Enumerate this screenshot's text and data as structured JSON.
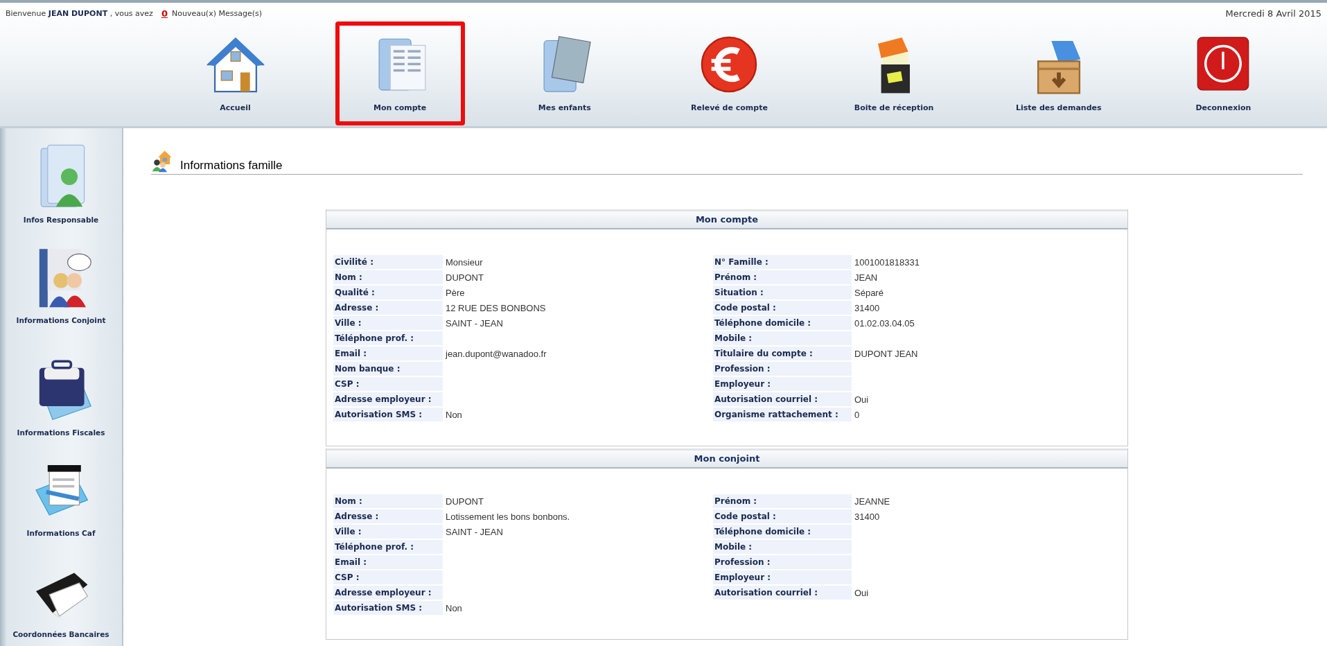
{
  "header": {
    "greeting": "Bienvenue **JEAN DUPONT** , vous avez",
    "message_count": "0",
    "message_label": "Nouveau(x) Message(s)",
    "date": "Mercredi 8 Avril 2015"
  },
  "nav": [
    {
      "label": "Accueil",
      "selected": false
    },
    {
      "label": "Mon compte",
      "selected": true
    },
    {
      "label": "Mes enfants",
      "selected": false
    },
    {
      "label": "Relevé de compte",
      "selected": false
    },
    {
      "label": "Boite de réception",
      "selected": false
    },
    {
      "label": "Liste des demandes",
      "selected": false
    },
    {
      "label": "Deconnexion",
      "selected": false
    }
  ],
  "sidebar": [
    {
      "label": "Infos Responsable"
    },
    {
      "label": "Informations Conjoint"
    },
    {
      "label": "Informations Fiscales"
    },
    {
      "label": "Informations Caf"
    },
    {
      "label": "Coordonnées Bancaires"
    }
  ],
  "page_title": "Informations famille",
  "panels": [
    {
      "title": "Mon compte",
      "left": [
        {
          "label": "Civilité :",
          "value": "Monsieur"
        },
        {
          "label": "Nom :",
          "value": "DUPONT"
        },
        {
          "label": "Qualité :",
          "value": "Père"
        },
        {
          "label": "Adresse :",
          "value": "12 RUE DES BONBONS"
        },
        {
          "label": "Ville :",
          "value": "SAINT - JEAN"
        },
        {
          "label": "Téléphone prof. :"
        },
        {
          "label": "Email :",
          "value": "jean.dupont@wanadoo.fr"
        },
        {
          "label": "Nom banque :"
        },
        {
          "label": "CSP :"
        },
        {
          "label": "Adresse employeur :"
        },
        {
          "label": "Autorisation SMS :",
          "value": "Non"
        }
      ],
      "right": [
        {
          "label": "N° Famille :",
          "value": "1001001818331"
        },
        {
          "label": "Prénom :",
          "value": "JEAN"
        },
        {
          "label": "Situation :",
          "value": "Séparé"
        },
        {
          "label": "Code postal :",
          "value": "31400"
        },
        {
          "label": "Téléphone domicile :",
          "value": "01.02.03.04.05"
        },
        {
          "label": "Mobile :"
        },
        {
          "label": "Titulaire du compte :",
          "value": "DUPONT JEAN"
        },
        {
          "label": "Profession :"
        },
        {
          "label": "Employeur :"
        },
        {
          "label": "Autorisation courriel :",
          "value": "Oui"
        },
        {
          "label": "Organisme rattachement :",
          "value": "0"
        }
      ]
    },
    {
      "title": "Mon conjoint",
      "left": [
        {
          "label": "Nom :",
          "value": "DUPONT"
        },
        {
          "label": "Adresse :",
          "value": "Lotissement les bons bonbons."
        },
        {
          "label": "Ville :",
          "value": "SAINT - JEAN"
        },
        {
          "label": "Téléphone prof. :"
        },
        {
          "label": "Email :"
        },
        {
          "label": "CSP :"
        },
        {
          "label": "Adresse employeur :"
        },
        {
          "label": "Autorisation SMS :",
          "value": "Non"
        }
      ],
      "right": [
        {
          "label": "Prénom :",
          "value": "JEANNE"
        },
        {
          "label": "Code postal :",
          "value": "31400"
        },
        {
          "label": "Téléphone domicile :"
        },
        {
          "label": "Mobile :"
        },
        {
          "label": "Profession :"
        },
        {
          "label": "Employeur :"
        },
        {
          "label": "Autorisation courriel :",
          "value": "Oui"
        }
      ]
    }
  ]
}
